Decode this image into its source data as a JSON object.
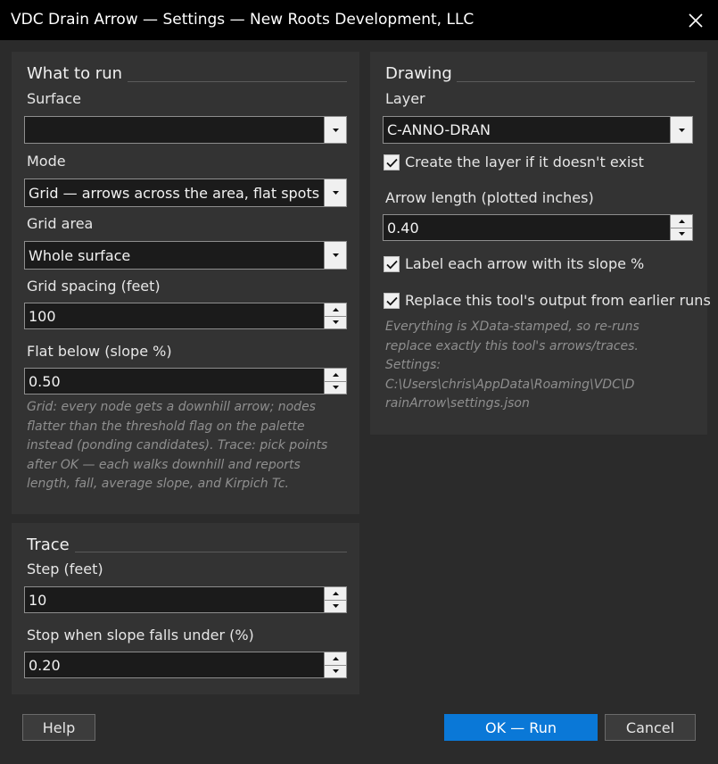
{
  "window": {
    "title": "VDC Drain Arrow — Settings — New Roots Development, LLC",
    "icons": {
      "close": "close-icon"
    }
  },
  "what_to_run": {
    "heading": "What to run",
    "surface": {
      "label": "Surface",
      "value": ""
    },
    "mode": {
      "label": "Mode",
      "value": "Grid — arrows across the area, flat spots flagged"
    },
    "grid_area": {
      "label": "Grid area",
      "value": "Whole surface"
    },
    "grid_spacing": {
      "label": "Grid spacing (feet)",
      "value": "100"
    },
    "flat_below": {
      "label": "Flat below (slope %)",
      "value": "0.50"
    },
    "help_text": [
      "Grid: every node gets a downhill arrow; nodes",
      "flatter than the threshold flag on the palette",
      "instead (ponding candidates). Trace: pick points",
      "after OK — each walks downhill and reports",
      "length, fall, average slope, and Kirpich Tc."
    ]
  },
  "trace": {
    "heading": "Trace",
    "step": {
      "label": "Step (feet)",
      "value": "10"
    },
    "stop_slope": {
      "label": "Stop when slope falls under (%)",
      "value": "0.20"
    }
  },
  "drawing": {
    "heading": "Drawing",
    "layer": {
      "label": "Layer",
      "value": "C-ANNO-DRAN"
    },
    "create_layer": {
      "label": "Create the layer if it doesn't exist",
      "checked": true
    },
    "arrow_length": {
      "label": "Arrow length (plotted inches)",
      "value": "0.40"
    },
    "label_slope": {
      "label": "Label each arrow with its slope %",
      "checked": true
    },
    "replace_output": {
      "label": "Replace this tool's output from earlier runs",
      "checked": true
    },
    "info_text": [
      "Everything is XData-stamped, so re-runs",
      "replace exactly this tool's arrows/traces.",
      "Settings:",
      "C:\\Users\\chris\\AppData\\Roaming\\VDC\\D",
      "rainArrow\\settings.json"
    ]
  },
  "buttons": {
    "help": "Help",
    "ok": "OK — Run",
    "cancel": "Cancel"
  }
}
